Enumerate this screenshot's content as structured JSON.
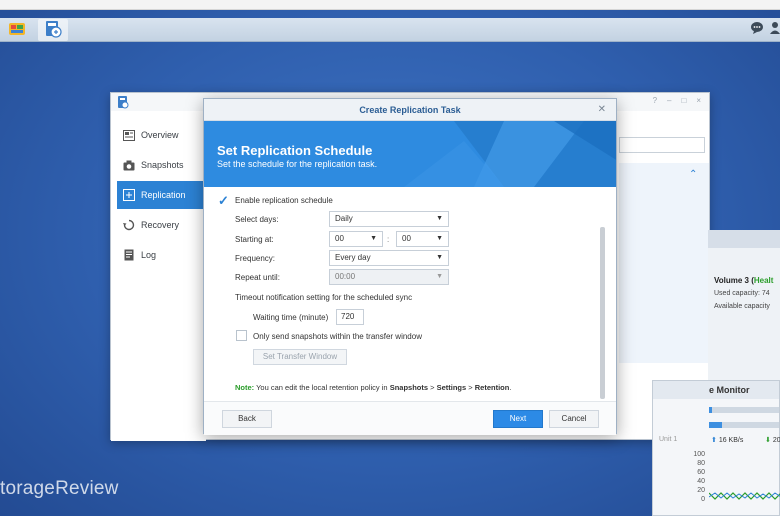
{
  "taskbar": {
    "apps": [
      "main-menu",
      "snapshot-replication"
    ]
  },
  "watermark": "torageReview",
  "background_window": {
    "sidebar": [
      {
        "label": "Overview",
        "icon": "overview-icon"
      },
      {
        "label": "Snapshots",
        "icon": "camera-icon"
      },
      {
        "label": "Replication",
        "icon": "replication-icon",
        "active": true
      },
      {
        "label": "Recovery",
        "icon": "recovery-icon"
      },
      {
        "label": "Log",
        "icon": "log-icon"
      }
    ]
  },
  "storage_widget": {
    "volume": "Volume 3 (",
    "status": "Healt",
    "used": "Used capacity: 74",
    "available": "Available capacity"
  },
  "resource_widget": {
    "title": "e Monitor",
    "upload": "16 KB/s",
    "download": "20",
    "unit_label": "Unit 1",
    "axis": [
      "100",
      "80",
      "60",
      "40",
      "20",
      "0"
    ]
  },
  "dialog": {
    "title": "Create Replication Task",
    "heading": "Set Replication Schedule",
    "subheading": "Set the schedule for the replication task.",
    "enable_label": "Enable replication schedule",
    "enable_checked": true,
    "select_days_label": "Select days:",
    "select_days_value": "Daily",
    "starting_at_label": "Starting at:",
    "start_hour": "00",
    "start_minute": "00",
    "colon": ":",
    "frequency_label": "Frequency:",
    "frequency_value": "Every day",
    "repeat_until_label": "Repeat until:",
    "repeat_until_value": "00:00",
    "timeout_label": "Timeout notification setting for the scheduled sync",
    "waiting_label": "Waiting time (minute)",
    "waiting_value": "720",
    "transfer_window_label": "Only send snapshots within the transfer window",
    "transfer_window_checked": false,
    "set_transfer_window_button": "Set Transfer Window",
    "note_prefix": "Note:",
    "note_text": " You can edit the local retention policy in ",
    "note_path_1": "Snapshots",
    "note_sep_1": " > ",
    "note_path_2": "Settings",
    "note_sep_2": " > ",
    "note_path_3": "Retention",
    "note_end": ".",
    "back_button": "Back",
    "next_button": "Next",
    "cancel_button": "Cancel"
  },
  "colors": {
    "accent": "#2c82d4",
    "header_blue": "#2e8be0",
    "desktop": "#2f5fae"
  }
}
